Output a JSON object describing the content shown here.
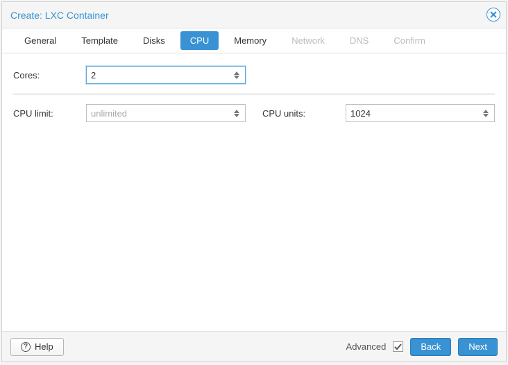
{
  "title": "Create: LXC Container",
  "tabs": {
    "general": "General",
    "template": "Template",
    "disks": "Disks",
    "cpu": "CPU",
    "memory": "Memory",
    "network": "Network",
    "dns": "DNS",
    "confirm": "Confirm"
  },
  "fields": {
    "cores_label": "Cores:",
    "cores_value": "2",
    "cpu_limit_label": "CPU limit:",
    "cpu_limit_placeholder": "unlimited",
    "cpu_units_label": "CPU units:",
    "cpu_units_value": "1024"
  },
  "footer": {
    "help": "Help",
    "advanced": "Advanced",
    "advanced_checked": true,
    "back": "Back",
    "next": "Next"
  }
}
